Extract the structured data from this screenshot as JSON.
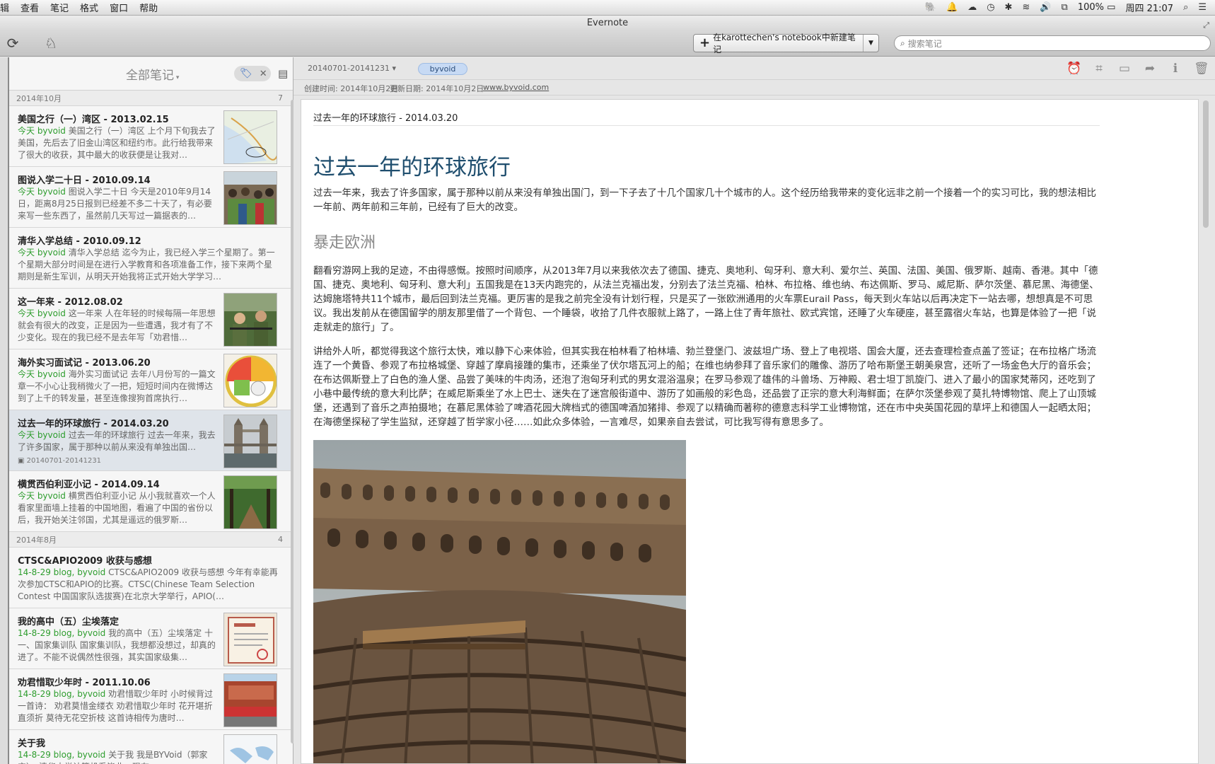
{
  "menubar": {
    "items": [
      "辑",
      "查看",
      "笔记",
      "格式",
      "窗口",
      "帮助"
    ],
    "status_icons": [
      "evernote-elephant-icon",
      "bell-icon",
      "cloud-icon",
      "time-machine-icon",
      "bluetooth-icon",
      "wifi-icon",
      "volume-icon",
      "input-method-icon"
    ],
    "battery": "100%",
    "clock": "周四 21:07"
  },
  "window": {
    "title": "Evernote"
  },
  "toolbar": {
    "new_note_label": "在karottechen's notebook中新建笔记",
    "search_placeholder": "搜索笔记"
  },
  "note_list": {
    "title": "全部笔记",
    "filter_tag": "byvoid",
    "groups": [
      {
        "label": "2014年10月",
        "count": "7",
        "notes": [
          {
            "title": "美国之行（一）湾区 - 2013.02.15",
            "meta": "今天  byvoid",
            "snippet": "美国之行（一）湾区 上个月下旬我去了美国，先后去了旧金山湾区和纽约市。此行给我带来了很大的收获，其中最大的收获便是让我对…"
          },
          {
            "title": "图说入学二十日 - 2010.09.14",
            "meta": "今天  byvoid",
            "snippet": "图说入学二十日 今天是2010年9月14日，距离8月25日报到已经差不多二十天了，有必要来写一些东西了，虽然前几天写过一篇据表的…"
          },
          {
            "title": "清华入学总结 - 2010.09.12",
            "meta": "今天  byvoid",
            "snippet": "清华入学总结 迄今为止，我已经入学三个星期了。第一个星期大部分时间是在进行入学教育和各项准备工作，接下来两个星期则是新生军训，从明天开始我将正式开始大学学习…"
          },
          {
            "title": "这一年来 - 2012.08.02",
            "meta": "今天  byvoid",
            "snippet": "这一年来 人在年轻的时候每隔一年思想就会有很大的改变，正是因为一些遭遇，我才有了不少变化。现在的我已经不是去年写「劝君惜…"
          },
          {
            "title": "海外实习面试记 - 2013.06.20",
            "meta": "今天  byvoid",
            "snippet": "海外实习面试记 去年八月份写的一篇文章一不小心让我稍微火了一把，短短时间内在微博达到了上千的转发量，甚至连像搜狗首席执行…"
          },
          {
            "title": "过去一年的环球旅行 - 2014.03.20",
            "meta": "今天  byvoid",
            "snippet": "过去一年的环球旅行 过去一年来，我去了许多国家，属于那种以前从来没有单独出国…",
            "notebook": "20140701-20141231",
            "selected": true
          },
          {
            "title": "横贯西伯利亚小记 - 2014.09.14",
            "meta": "今天  byvoid",
            "snippet": "横贯西伯利亚小记 从小我就喜欢一个人看家里面墙上挂着的中国地图，看遍了中国的省份以后，我开始关注邻国，尤其是遥远的俄罗斯…"
          }
        ]
      },
      {
        "label": "2014年8月",
        "count": "4",
        "notes": [
          {
            "title": "CTSC&APIO2009 收获与感想",
            "meta": "14-8-29  blog, byvoid",
            "snippet": "CTSC&APIO2009 收获与感想 今年有幸能再次参加CTSC和APIO的比赛。CTSC(Chinese Team Selection Contest 中国国家队选拔赛)在北京大学举行，APIO(…"
          },
          {
            "title": "我的高中（五）尘埃落定",
            "meta": "14-8-29  blog, byvoid",
            "snippet": "我的高中（五）尘埃落定 十一、国家集训队 国家集训队，我想都没想过，却真的进了。不能不说偶然性很强，其实国家级集…"
          },
          {
            "title": "劝君惜取少年时 - 2011.10.06",
            "meta": "14-8-29  blog, byvoid",
            "snippet": "劝君惜取少年时 小时候背过一首诗： 劝君莫惜金缕衣 劝君惜取少年时 花开堪折直须折 莫待无花空折枝 这首诗相传为唐时…"
          },
          {
            "title": "关于我",
            "meta": "14-8-29  blog, byvoid",
            "snippet": "关于我 我是BYVoid（郭家宝），清华大学计算机系毕业，现在…"
          }
        ]
      }
    ]
  },
  "note_view": {
    "notebook": "20140701-20141231",
    "tag": "byvoid",
    "created": "创建时间: 2014年10月2日",
    "updated": "更新日期: 2014年10月2日",
    "source_url": "www.byvoid.com",
    "note_title": "过去一年的环球旅行 - 2014.03.20",
    "heading": "过去一年的环球旅行",
    "para1": "过去一年来，我去了许多国家，属于那种以前从来没有单独出国门，到一下子去了十几个国家几十个城市的人。这个经历给我带来的变化远非之前一个接着一个的实习可比，我的想法相比一年前、两年前和三年前，已经有了巨大的改变。",
    "subheading": "暴走欧洲",
    "para2": "翻看穷游网上我的足迹，不由得感慨。按照时间顺序，从2013年7月以来我依次去了德国、捷克、奥地利、匈牙利、意大利、爱尔兰、英国、法国、美国、俄罗斯、越南、香港。其中「德国、捷克、奥地利、匈牙利、意大利」五国我是在13天内跑完的，从法兰克福出发，分别去了法兰克福、柏林、布拉格、维也纳、布达佩斯、罗马、威尼斯、萨尔茨堡、慕尼黑、海德堡、达姆施塔特共11个城市，最后回到法兰克福。更厉害的是我之前完全没有计划行程，只是买了一张欧洲通用的火车票Eurail Pass，每天到火车站以后再决定下一站去哪，想想真是不可思议。我出发前从在德国留学的朋友那里借了一个背包、一个睡袋，收拾了几件衣服就上路了，一路上住了青年旅社、欧式宾馆，还睡了火车硬座，甚至露宿火车站，也算是体验了一把「说走就走的旅行」了。",
    "para3": "讲给外人听，都觉得我这个旅行太快，难以静下心来体验，但其实我在柏林看了柏林墙、勃兰登堡门、波兹坦广场、登上了电视塔、国会大厦，还去查理检查点盖了签证；在布拉格广场流连了一个黄昏、参观了布拉格城堡、穿越了摩肩接踵的集市，还乘坐了伏尔塔瓦河上的船；在维也纳参拜了音乐家们的雕像、游历了哈布斯堡王朝美泉宫，还听了一场金色大厅的音乐会；在布达佩斯登上了白色的渔人堡、品尝了美味的牛肉汤，还泡了泡匈牙利式的男女混浴温泉；在罗马参观了雄伟的斗兽场、万神殿、君士坦丁凯旋门、进入了最小的国家梵蒂冈，还吃到了小巷中最传统的意大利比萨；在威尼斯乘坐了水上巴士、迷失在了迷宫般街道中、游历了如画般的彩色岛，还品尝了正宗的意大利海鲜面；在萨尔茨堡参观了莫扎特博物馆、爬上了山顶城堡，还遇到了音乐之声拍摄地；在慕尼黑体验了啤酒花园大牌档式的德国啤酒加猪排、参观了以精确而著称的德意志科学工业博物馆，还在市中央英国花园的草坪上和德国人一起晒太阳；在海德堡探秘了学生监狱，还穿越了哲学家小径……如此众多体验，一言难尽，如果亲自去尝试，可比我写得有意思多了。"
  },
  "colors": {
    "heading": "#1f4e6e",
    "meta_green": "#2e9d2e",
    "tag_chip": "#c7daf4"
  }
}
